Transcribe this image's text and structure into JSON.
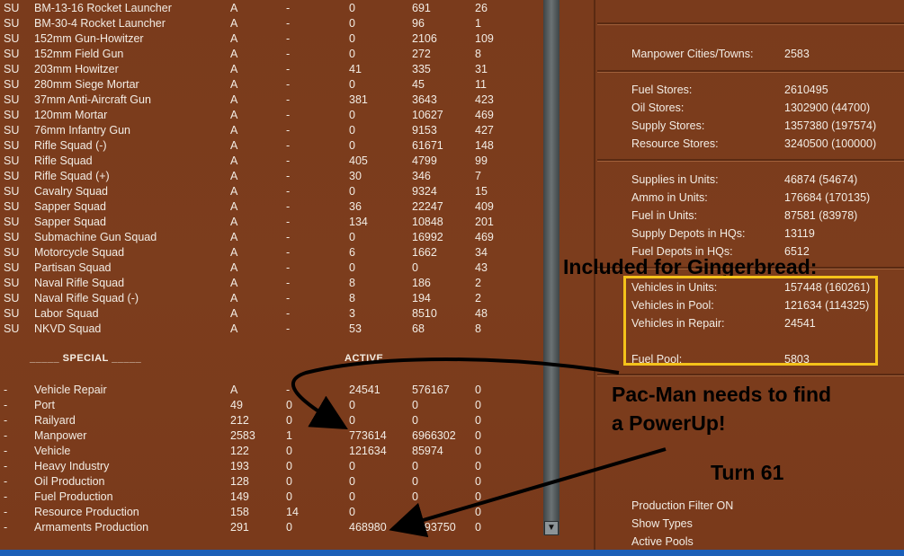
{
  "units": [
    {
      "nat": "SU",
      "name": "BM-13-16 Rocket Launcher",
      "a": "A",
      "b": "-",
      "c": "0",
      "d": "691",
      "e": "26"
    },
    {
      "nat": "SU",
      "name": "BM-30-4 Rocket Launcher",
      "a": "A",
      "b": "-",
      "c": "0",
      "d": "96",
      "e": "1"
    },
    {
      "nat": "SU",
      "name": "152mm Gun-Howitzer",
      "a": "A",
      "b": "-",
      "c": "0",
      "d": "2106",
      "e": "109"
    },
    {
      "nat": "SU",
      "name": "152mm Field Gun",
      "a": "A",
      "b": "-",
      "c": "0",
      "d": "272",
      "e": "8"
    },
    {
      "nat": "SU",
      "name": "203mm Howitzer",
      "a": "A",
      "b": "-",
      "c": "41",
      "d": "335",
      "e": "31"
    },
    {
      "nat": "SU",
      "name": "280mm Siege Mortar",
      "a": "A",
      "b": "-",
      "c": "0",
      "d": "45",
      "e": "11"
    },
    {
      "nat": "SU",
      "name": "37mm Anti-Aircraft Gun",
      "a": "A",
      "b": "-",
      "c": "381",
      "d": "3643",
      "e": "423"
    },
    {
      "nat": "SU",
      "name": "120mm Mortar",
      "a": "A",
      "b": "-",
      "c": "0",
      "d": "10627",
      "e": "469"
    },
    {
      "nat": "SU",
      "name": "76mm Infantry Gun",
      "a": "A",
      "b": "-",
      "c": "0",
      "d": "9153",
      "e": "427"
    },
    {
      "nat": "SU",
      "name": "Rifle Squad (-)",
      "a": "A",
      "b": "-",
      "c": "0",
      "d": "61671",
      "e": "148"
    },
    {
      "nat": "SU",
      "name": "Rifle Squad",
      "a": "A",
      "b": "-",
      "c": "405",
      "d": "4799",
      "e": "99"
    },
    {
      "nat": "SU",
      "name": "Rifle Squad (+)",
      "a": "A",
      "b": "-",
      "c": "30",
      "d": "346",
      "e": "7"
    },
    {
      "nat": "SU",
      "name": "Cavalry Squad",
      "a": "A",
      "b": "-",
      "c": "0",
      "d": "9324",
      "e": "15"
    },
    {
      "nat": "SU",
      "name": "Sapper Squad",
      "a": "A",
      "b": "-",
      "c": "36",
      "d": "22247",
      "e": "409"
    },
    {
      "nat": "SU",
      "name": "Sapper Squad",
      "a": "A",
      "b": "-",
      "c": "134",
      "d": "10848",
      "e": "201"
    },
    {
      "nat": "SU",
      "name": "Submachine Gun Squad",
      "a": "A",
      "b": "-",
      "c": "0",
      "d": "16992",
      "e": "469"
    },
    {
      "nat": "SU",
      "name": "Motorcycle Squad",
      "a": "A",
      "b": "-",
      "c": "6",
      "d": "1662",
      "e": "34"
    },
    {
      "nat": "SU",
      "name": "Partisan Squad",
      "a": "A",
      "b": "-",
      "c": "0",
      "d": "0",
      "e": "43"
    },
    {
      "nat": "SU",
      "name": "Naval Rifle Squad",
      "a": "A",
      "b": "-",
      "c": "8",
      "d": "186",
      "e": "2"
    },
    {
      "nat": "SU",
      "name": "Naval Rifle Squad (-)",
      "a": "A",
      "b": "-",
      "c": "8",
      "d": "194",
      "e": "2"
    },
    {
      "nat": "SU",
      "name": "Labor Squad",
      "a": "A",
      "b": "-",
      "c": "3",
      "d": "8510",
      "e": "48"
    },
    {
      "nat": "SU",
      "name": "NKVD Squad",
      "a": "A",
      "b": "-",
      "c": "53",
      "d": "68",
      "e": "8"
    }
  ],
  "special_header": "_____ SPECIAL _____",
  "active_header": "ACTIVE",
  "special": [
    {
      "nat": "-",
      "name": "Vehicle Repair",
      "a": "A",
      "b": "-",
      "c": "24541",
      "d": "576167",
      "e": "0"
    },
    {
      "nat": "-",
      "name": "Port",
      "a": "49",
      "b": "0",
      "c": "0",
      "d": "0",
      "e": "0"
    },
    {
      "nat": "-",
      "name": "Railyard",
      "a": "212",
      "b": "0",
      "c": "0",
      "d": "0",
      "e": "0"
    },
    {
      "nat": "-",
      "name": "Manpower",
      "a": "2583",
      "b": "1",
      "c": "773614",
      "d": "6966302",
      "e": "0"
    },
    {
      "nat": "-",
      "name": "Vehicle",
      "a": "122",
      "b": "0",
      "c": "121634",
      "d": "85974",
      "e": "0"
    },
    {
      "nat": "-",
      "name": "Heavy Industry",
      "a": "193",
      "b": "0",
      "c": "0",
      "d": "0",
      "e": "0"
    },
    {
      "nat": "-",
      "name": "Oil Production",
      "a": "128",
      "b": "0",
      "c": "0",
      "d": "0",
      "e": "0"
    },
    {
      "nat": "-",
      "name": "Fuel Production",
      "a": "149",
      "b": "0",
      "c": "0",
      "d": "0",
      "e": "0"
    },
    {
      "nat": "-",
      "name": "Resource Production",
      "a": "158",
      "b": "14",
      "c": "0",
      "d": "0",
      "e": "0"
    },
    {
      "nat": "-",
      "name": "Armaments Production",
      "a": "291",
      "b": "0",
      "c": "468980",
      "d": "4793750",
      "e": "0"
    }
  ],
  "stats": {
    "manpower_label": "Manpower Cities/Towns:",
    "manpower_val": "2583",
    "fuel_stores_label": "Fuel Stores:",
    "fuel_stores_val": "2610495",
    "oil_stores_label": "Oil Stores:",
    "oil_stores_val": "1302900 (44700)",
    "supply_stores_label": "Supply Stores:",
    "supply_stores_val": "1357380 (197574)",
    "resource_stores_label": "Resource Stores:",
    "resource_stores_val": "3240500 (100000)",
    "supplies_units_label": "Supplies in Units:",
    "supplies_units_val": "46874 (54674)",
    "ammo_units_label": "Ammo in Units:",
    "ammo_units_val": "176684 (170135)",
    "fuel_units_label": "Fuel in Units:",
    "fuel_units_val": "87581 (83978)",
    "supply_depots_label": "Supply Depots in HQs:",
    "supply_depots_val": "13119",
    "fuel_depots_label": "Fuel Depots in HQs:",
    "fuel_depots_val": "6512",
    "veh_units_label": "Vehicles in Units:",
    "veh_units_val": "157448 (160261)",
    "veh_pool_label": "Vehicles in Pool:",
    "veh_pool_val": "121634 (114325)",
    "veh_repair_label": "Vehicles in Repair:",
    "veh_repair_val": "24541",
    "fuel_pool_label": "Fuel Pool:",
    "fuel_pool_val": "5803"
  },
  "menu": {
    "prod_filter": "Production Filter ON",
    "show_types": "Show Types",
    "active_pools": "Active Pools"
  },
  "annotations": {
    "gingerbread": "Included for Gingerbread:",
    "pacman1": "Pac-Man needs to find",
    "pacman2": "a PowerUp!",
    "turn": "Turn 61"
  },
  "colors": {
    "highlight_box": "#f4c21a",
    "panel": "#7a3b1c",
    "statusbar": "#1a5fb8"
  }
}
